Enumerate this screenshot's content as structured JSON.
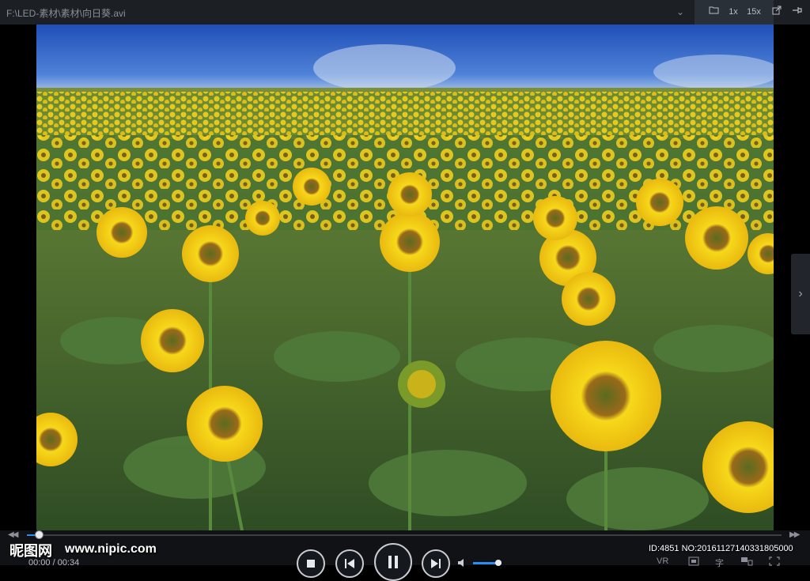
{
  "titlebar": {
    "file_path": "F:\\LED-素材\\素材\\向日葵.avi",
    "dropdown_icon": "chevron-down-icon",
    "folder_icon": "folder-icon",
    "speed_1x": "1x",
    "speed_15x": "15x",
    "popout_icon": "popout-icon",
    "pin_icon": "pin-icon"
  },
  "video": {
    "side_handle_icon": "chevron-right-icon"
  },
  "controls": {
    "time_display": "00:00 / 00:34",
    "progress_fraction": 0.015,
    "volume_fraction": 0.8,
    "vr_label": "VR",
    "subtitle_label": "字",
    "stop_icon": "stop-icon",
    "prev_icon": "previous-icon",
    "pause_icon": "pause-icon",
    "next_icon": "next-icon",
    "volume_icon": "volume-icon",
    "skip_back_icon": "skip-back-icon",
    "skip_forward_icon": "skip-forward-icon"
  },
  "watermark": {
    "logo": "昵图网",
    "url": "www.nipic.com",
    "id_text": "ID:4851 NO:20161127140331805000"
  },
  "colors": {
    "accent": "#2d8cf0",
    "titlebar_bg": "#1c1f24",
    "sky_top": "#1f4fb8",
    "sunflower_petal": "#f7d81a",
    "leaf": "#4f7a3a"
  }
}
